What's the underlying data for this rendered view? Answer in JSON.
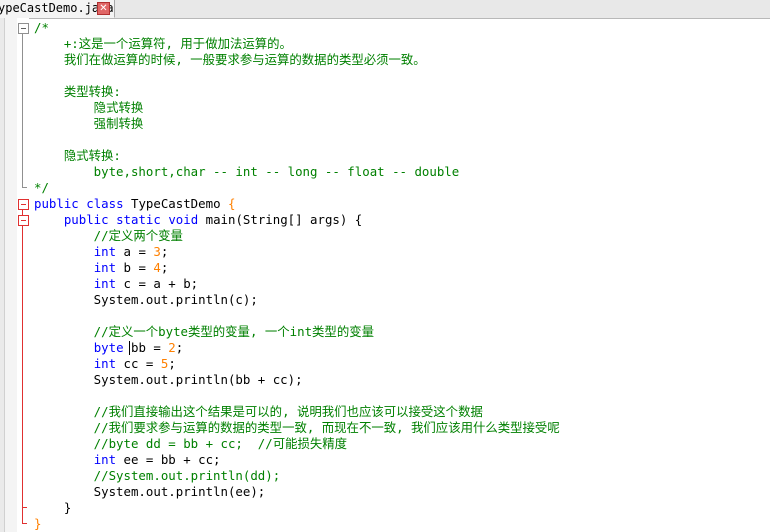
{
  "tab": {
    "label": "ypeCastDemo.java",
    "close": "✕"
  },
  "lines": [
    [
      {
        "t": "/*",
        "c": "c"
      }
    ],
    [
      {
        "t": "    +:这是一个运算符, 用于做加法运算的。",
        "c": "c"
      }
    ],
    [
      {
        "t": "    我们在做运算的时候, 一般要求参与运算的数据的类型必须一致。",
        "c": "c"
      }
    ],
    [],
    [
      {
        "t": "    类型转换:",
        "c": "c"
      }
    ],
    [
      {
        "t": "        隐式转换",
        "c": "c"
      }
    ],
    [
      {
        "t": "        强制转换",
        "c": "c"
      }
    ],
    [],
    [
      {
        "t": "    隐式转换:",
        "c": "c"
      }
    ],
    [
      {
        "t": "        byte,short,char -- int -- long -- float -- double",
        "c": "c"
      }
    ],
    [
      {
        "t": "*/",
        "c": "c"
      }
    ],
    [
      {
        "t": "public",
        "c": "k"
      },
      {
        "t": " ",
        "c": "t"
      },
      {
        "t": "class",
        "c": "k"
      },
      {
        "t": " TypeCastDemo ",
        "c": "t"
      },
      {
        "t": "{",
        "c": "n"
      }
    ],
    [
      {
        "t": "    ",
        "c": "t"
      },
      {
        "t": "public",
        "c": "k"
      },
      {
        "t": " ",
        "c": "t"
      },
      {
        "t": "static",
        "c": "k"
      },
      {
        "t": " ",
        "c": "t"
      },
      {
        "t": "void",
        "c": "k"
      },
      {
        "t": " main(String[] args) {",
        "c": "t"
      }
    ],
    [
      {
        "t": "        //定义两个变量",
        "c": "c"
      }
    ],
    [
      {
        "t": "        ",
        "c": "t"
      },
      {
        "t": "int",
        "c": "k"
      },
      {
        "t": " a = ",
        "c": "t"
      },
      {
        "t": "3",
        "c": "n"
      },
      {
        "t": ";",
        "c": "t"
      }
    ],
    [
      {
        "t": "        ",
        "c": "t"
      },
      {
        "t": "int",
        "c": "k"
      },
      {
        "t": " b = ",
        "c": "t"
      },
      {
        "t": "4",
        "c": "n"
      },
      {
        "t": ";",
        "c": "t"
      }
    ],
    [
      {
        "t": "        ",
        "c": "t"
      },
      {
        "t": "int",
        "c": "k"
      },
      {
        "t": " c = a + b;",
        "c": "t"
      }
    ],
    [
      {
        "t": "        System.out.println(c);",
        "c": "t"
      }
    ],
    [],
    [
      {
        "t": "        //定义一个byte类型的变量, 一个int类型的变量",
        "c": "c"
      }
    ],
    [
      {
        "t": "        ",
        "c": "t"
      },
      {
        "t": "byte",
        "c": "k"
      },
      {
        "t": " bb = ",
        "c": "t"
      },
      {
        "t": "2",
        "c": "n"
      },
      {
        "t": ";",
        "c": "t"
      }
    ],
    [
      {
        "t": "        ",
        "c": "t"
      },
      {
        "t": "int",
        "c": "k"
      },
      {
        "t": " cc = ",
        "c": "t"
      },
      {
        "t": "5",
        "c": "n"
      },
      {
        "t": ";",
        "c": "t"
      }
    ],
    [
      {
        "t": "        System.out.println(bb + cc);",
        "c": "t"
      }
    ],
    [],
    [
      {
        "t": "        //我们直接输出这个结果是可以的, 说明我们也应该可以接受这个数据",
        "c": "c"
      }
    ],
    [
      {
        "t": "        //我们要求参与运算的数据的类型一致, 而现在不一致, 我们应该用什么类型接受呢",
        "c": "c"
      }
    ],
    [
      {
        "t": "        //byte dd = bb + cc;  //可能损失精度",
        "c": "c"
      }
    ],
    [
      {
        "t": "        ",
        "c": "t"
      },
      {
        "t": "int",
        "c": "k"
      },
      {
        "t": " ee = bb + cc;",
        "c": "t"
      }
    ],
    [
      {
        "t": "        //System.out.println(dd);",
        "c": "c"
      }
    ],
    [
      {
        "t": "        System.out.println(ee);",
        "c": "t"
      }
    ],
    [
      {
        "t": "    }",
        "c": "t"
      }
    ],
    [
      {
        "t": "}",
        "c": "n"
      }
    ]
  ]
}
